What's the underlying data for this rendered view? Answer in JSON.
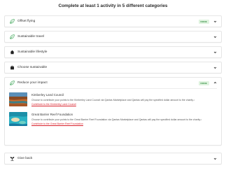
{
  "page_title": "Complete at least 1 activity in 5 different categories",
  "colors": {
    "done_badge_bg": "#dff3df",
    "done_badge_text": "#2e8b3d",
    "link": "#d9232d"
  },
  "categories": [
    {
      "label": "Offset flying",
      "icon": "leaf-icon",
      "badge": "DONE",
      "expanded": false
    },
    {
      "label": "Sustainable travel",
      "icon": "leaf-icon",
      "expanded": false
    },
    {
      "label": "Sustainable lifestyle",
      "icon": "house-icon",
      "expanded": false
    },
    {
      "label": "Choose sustainable",
      "icon": "shopping-bag-icon",
      "expanded": false
    },
    {
      "label": "Reduce your impact",
      "icon": "leaf-icon",
      "badge": "DONE",
      "expanded": true
    },
    {
      "label": "Give back",
      "icon": "sprout-icon",
      "expanded": false
    }
  ],
  "reduce_items": [
    {
      "title": "Kimberley Land Council",
      "description": "Choose to contribute your points to the Kimberley Land Council via Qantas Marketplace and Qantas will pay the specified dollar amount to the charity.¹",
      "link": "Contribute to the Kimberley Land Council"
    },
    {
      "title": "Great Barrier Reef Foundation",
      "description": "Choose to contribute your points to the Great Barrier Reef Foundation via Qantas Marketplace and Qantas will pay the specified dollar amount to the charity.¹",
      "link": "Contribute to the Great Barrier Reef Foundation"
    }
  ]
}
